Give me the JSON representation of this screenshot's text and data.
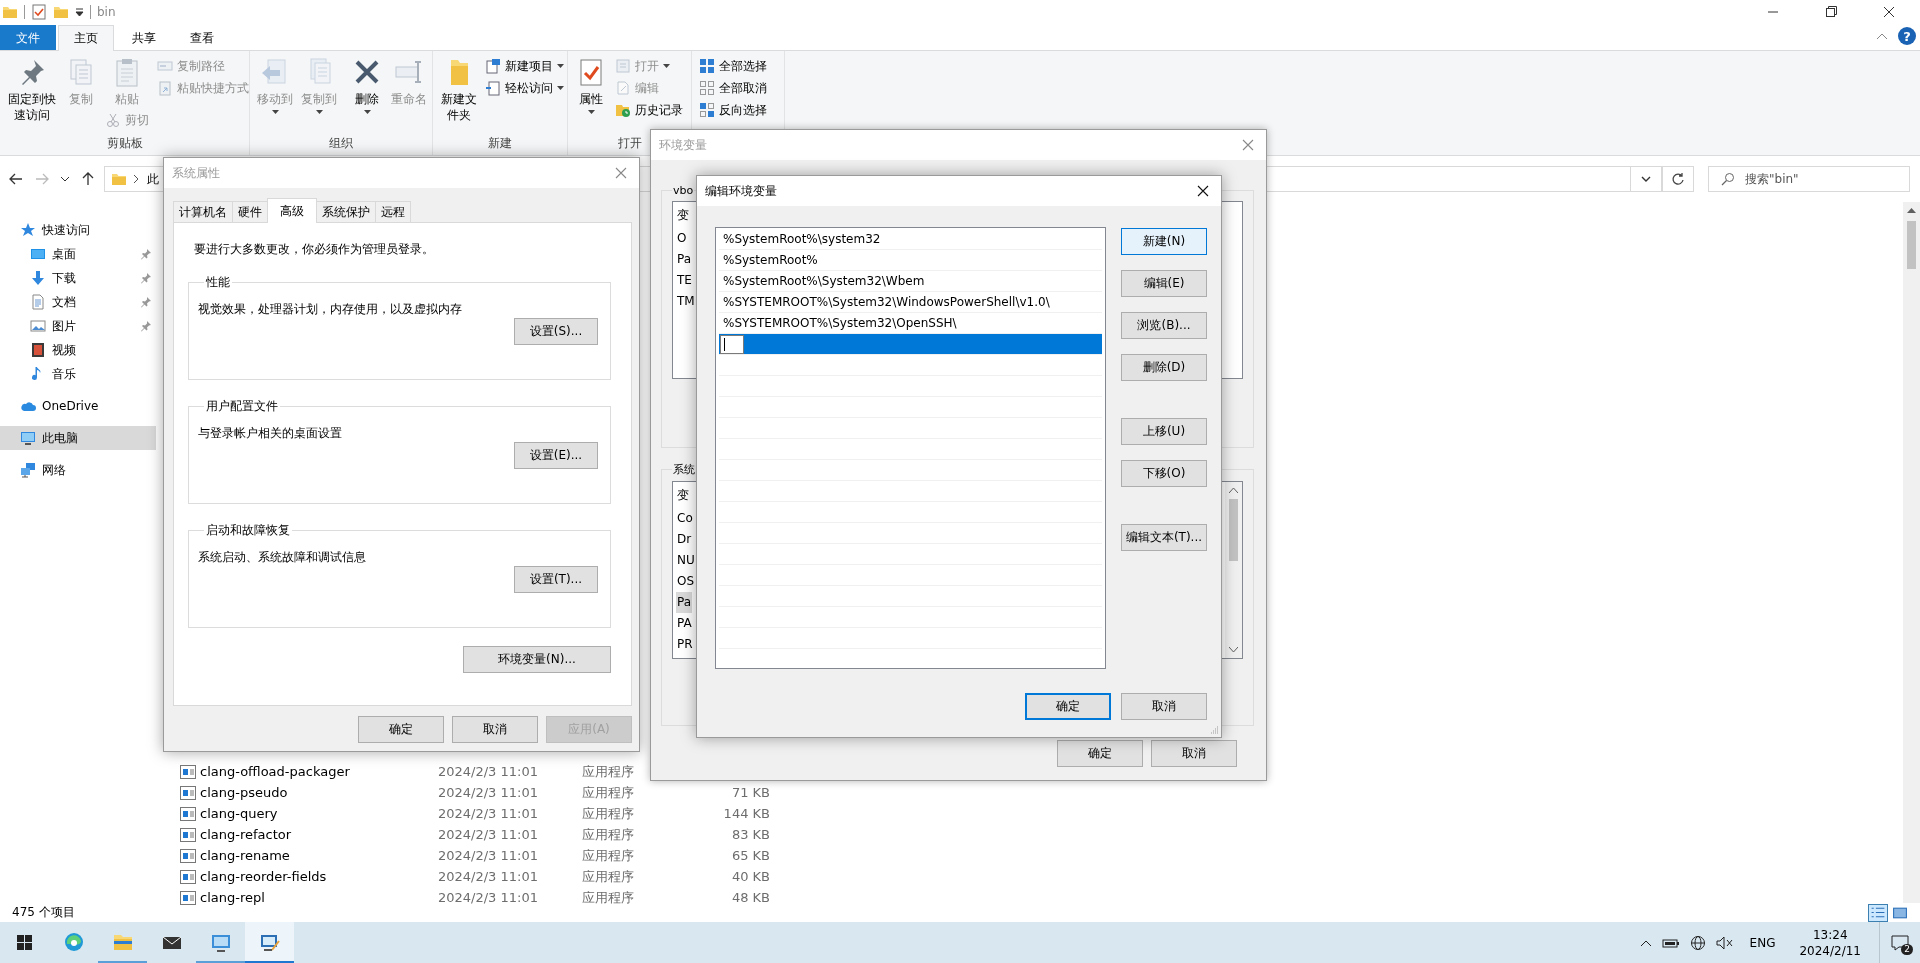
{
  "explorer": {
    "title": "bin",
    "help_glyph": "?",
    "ribbon_tabs": [
      {
        "label": "文件",
        "kind": "menu",
        "selected": false
      },
      {
        "label": "主页",
        "kind": "tab",
        "selected": true
      },
      {
        "label": "共享",
        "kind": "tab",
        "selected": false
      },
      {
        "label": "查看",
        "kind": "tab",
        "selected": false
      }
    ],
    "ribbon_groups": [
      {
        "label": "剪贴板",
        "items": [
          {
            "kind": "large",
            "label": "固定到快速访问",
            "disabled": false,
            "dropdown": false
          },
          {
            "kind": "large",
            "label": "复制",
            "disabled": true,
            "dropdown": false
          },
          {
            "kind": "large",
            "label": "粘贴",
            "disabled": true,
            "dropdown": false,
            "below": {
              "label": "剪切",
              "disabled": true
            }
          },
          {
            "kind": "stack",
            "items": [
              {
                "label": "复制路径",
                "disabled": true,
                "dropdown": false
              },
              {
                "label": "粘贴快捷方式",
                "disabled": true,
                "dropdown": false
              }
            ]
          }
        ]
      },
      {
        "label": "组织",
        "items": [
          {
            "kind": "large",
            "label": "移动到",
            "disabled": true,
            "dropdown": true
          },
          {
            "kind": "large",
            "label": "复制到",
            "disabled": true,
            "dropdown": true
          },
          {
            "kind": "large",
            "label": "删除",
            "disabled": false,
            "dropdown": true
          },
          {
            "kind": "large",
            "label": "重命名",
            "disabled": true,
            "dropdown": false
          }
        ]
      },
      {
        "label": "新建",
        "items": [
          {
            "kind": "large",
            "label": "新建文件夹",
            "disabled": false,
            "dropdown": false
          },
          {
            "kind": "stack",
            "items": [
              {
                "label": "新建项目",
                "disabled": false,
                "dropdown": true
              },
              {
                "label": "轻松访问",
                "disabled": false,
                "dropdown": true
              }
            ]
          }
        ]
      },
      {
        "label": "打开",
        "items": [
          {
            "kind": "large",
            "label": "属性",
            "disabled": false,
            "dropdown": true
          },
          {
            "kind": "stack",
            "items": [
              {
                "label": "打开",
                "disabled": true,
                "dropdown": true
              },
              {
                "label": "编辑",
                "disabled": true,
                "dropdown": false
              },
              {
                "label": "历史记录",
                "disabled": false,
                "dropdown": false
              }
            ]
          }
        ]
      },
      {
        "items": [
          {
            "kind": "stack",
            "items": [
              {
                "label": "全部选择",
                "disabled": false,
                "dropdown": false
              },
              {
                "label": "全部取消",
                "disabled": false,
                "dropdown": false
              },
              {
                "label": "反向选择",
                "disabled": false,
                "dropdown": false
              }
            ]
          }
        ]
      }
    ],
    "address_text": "此",
    "search_placeholder": "搜索\"bin\"",
    "nav": [
      {
        "label": "快速访问",
        "selected": false,
        "pinned": false,
        "children": [
          {
            "label": "桌面",
            "selected": false,
            "pinned": true
          },
          {
            "label": "下载",
            "selected": false,
            "pinned": true
          },
          {
            "label": "文档",
            "selected": false,
            "pinned": true
          },
          {
            "label": "图片",
            "selected": false,
            "pinned": true
          },
          {
            "label": "视频",
            "selected": false,
            "pinned": false
          },
          {
            "label": "音乐",
            "selected": false,
            "pinned": false
          }
        ]
      },
      {
        "label": "OneDrive",
        "selected": false,
        "pinned": false
      },
      {
        "label": "此电脑",
        "selected": true,
        "pinned": false
      },
      {
        "label": "网络",
        "selected": false,
        "pinned": false
      }
    ],
    "files": [
      {
        "name": "clang-offload-packager",
        "date": "2024/2/3 11:01",
        "type": "应用程序"
      },
      {
        "name": "clang-pseudo",
        "date": "2024/2/3 11:01",
        "type": "应用程序",
        "size": "71 KB"
      },
      {
        "name": "clang-query",
        "date": "2024/2/3 11:01",
        "type": "应用程序",
        "size": "144 KB"
      },
      {
        "name": "clang-refactor",
        "date": "2024/2/3 11:01",
        "type": "应用程序",
        "size": "83 KB"
      },
      {
        "name": "clang-rename",
        "date": "2024/2/3 11:01",
        "type": "应用程序",
        "size": "65 KB"
      },
      {
        "name": "clang-reorder-fields",
        "date": "2024/2/3 11:01",
        "type": "应用程序",
        "size": "40 KB"
      },
      {
        "name": "clang-repl",
        "date": "2024/2/3 11:01",
        "type": "应用程序",
        "size": "48 KB"
      }
    ],
    "status_bar": {
      "item_count": "475 个项目",
      "view_modes": [
        {
          "selected": true
        },
        {
          "selected": false
        }
      ]
    }
  },
  "system_properties": {
    "title": "系统属性",
    "active": false,
    "tabs": [
      {
        "label": "计算机名",
        "selected": false
      },
      {
        "label": "硬件",
        "selected": false
      },
      {
        "label": "高级",
        "selected": true
      },
      {
        "label": "系统保护",
        "selected": false
      },
      {
        "label": "远程",
        "selected": false
      }
    ],
    "notice": "要进行大多数更改，你必须作为管理员登录。",
    "groups": [
      {
        "legend": "性能",
        "description": "视觉效果，处理器计划，内存使用，以及虚拟内存",
        "button": "设置(S)..."
      },
      {
        "legend": "用户配置文件",
        "description": "与登录帐户相关的桌面设置",
        "button": "设置(E)..."
      },
      {
        "legend": "启动和故障恢复",
        "description": "系统启动、系统故障和调试信息",
        "button": "设置(T)..."
      }
    ],
    "env_button": "环境变量(N)...",
    "buttons": [
      {
        "label": "确定",
        "disabled": false
      },
      {
        "label": "取消",
        "disabled": false
      },
      {
        "label": "应用(A)",
        "disabled": true
      }
    ]
  },
  "environment_variables": {
    "title": "环境变量",
    "active": false,
    "user_group": {
      "legend": "vbo",
      "header": "变",
      "rows": [
        {
          "text": "O",
          "selected": false
        },
        {
          "text": "Pa",
          "selected": false
        },
        {
          "text": "TE",
          "selected": false
        },
        {
          "text": "TM",
          "selected": false
        }
      ]
    },
    "system_group": {
      "legend": "系统",
      "header": "变",
      "rows": [
        {
          "text": "Co",
          "selected": false
        },
        {
          "text": "Dr",
          "selected": false
        },
        {
          "text": "NU",
          "selected": false
        },
        {
          "text": "OS",
          "selected": false
        },
        {
          "text": "Pa",
          "selected": true
        },
        {
          "text": "PA",
          "selected": false
        },
        {
          "text": "PR",
          "selected": false
        }
      ]
    },
    "buttons": [
      {
        "label": "确定"
      },
      {
        "label": "取消"
      }
    ]
  },
  "edit_variable": {
    "title": "编辑环境变量",
    "active": true,
    "entries": [
      {
        "text": "%SystemRoot%\\system32",
        "selected": false,
        "editing": false
      },
      {
        "text": "%SystemRoot%",
        "selected": false,
        "editing": false
      },
      {
        "text": "%SystemRoot%\\System32\\Wbem",
        "selected": false,
        "editing": false
      },
      {
        "text": "%SYSTEMROOT%\\System32\\WindowsPowerShell\\v1.0\\",
        "selected": false,
        "editing": false
      },
      {
        "text": "%SYSTEMROOT%\\System32\\OpenSSH\\",
        "selected": false,
        "editing": false
      },
      {
        "selected": true,
        "editing": true
      }
    ],
    "side_buttons": [
      {
        "label": "新建(N)",
        "hover": true
      },
      {
        "label": "编辑(E)",
        "hover": false
      },
      {
        "label": "浏览(B)...",
        "hover": false
      },
      {
        "label": "删除(D)",
        "hover": false
      },
      {
        "label": "上移(U)",
        "hover": false
      },
      {
        "label": "下移(O)",
        "hover": false
      },
      {
        "label": "编辑文本(T)...",
        "hover": false
      }
    ],
    "buttons": [
      {
        "label": "确定",
        "default": true
      },
      {
        "label": "取消",
        "default": false
      }
    ]
  },
  "taskbar": {
    "apps": [
      {
        "running": false,
        "selected": false
      },
      {
        "running": true,
        "selected": false
      },
      {
        "running": false,
        "selected": false
      },
      {
        "running": true,
        "selected": false
      },
      {
        "running": true,
        "selected": true
      }
    ],
    "language": "ENG",
    "time": "13:24",
    "date": "2024/2/11",
    "notifications": "2"
  }
}
